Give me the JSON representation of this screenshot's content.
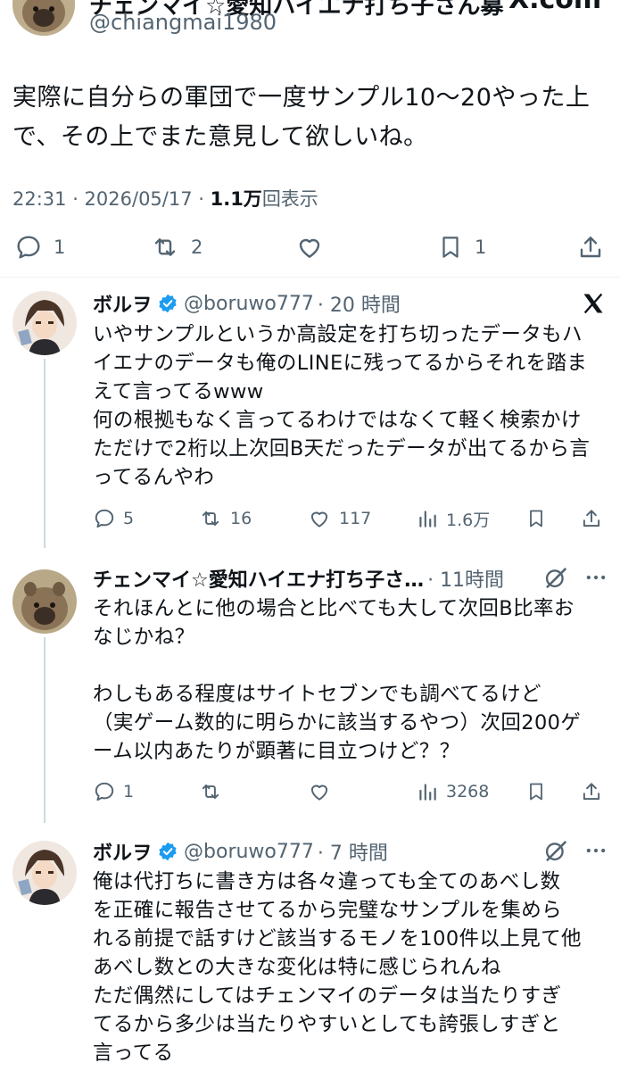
{
  "main_tweet": {
    "author_name": "チェンマイ☆愛知ハイエナ打ち子さん募",
    "brand": "X.com",
    "handle": "@chiangmai1980",
    "text_lines": [
      "実際に自分らの軍団で一度サンプル10〜20やった上",
      "で、その上でまた意見して欲しいね。"
    ],
    "time": "22:31 · 2026/05/17 · ",
    "views_count": "1.1万",
    "views_label": "回表示",
    "stats": {
      "replies": "1",
      "reposts": "2",
      "bookmarks": "1"
    }
  },
  "replies": [
    {
      "author_name": "ボルヲ",
      "handle": "@boruwo777",
      "time": "· 20 時間",
      "right_icon": "x-logo-icon",
      "text_lines": [
        "いやサンプルというか高設定を打ち切ったデータもハ",
        "イエナのデータも俺のLINEに残ってるからそれを踏ま",
        "えて言ってるwww",
        "何の根拠もなく言ってるわけではなくて軽く検索かけ",
        "ただけで2桁以上次回B天だったデータが出てるから言",
        "ってるんやわ"
      ],
      "stats": {
        "replies": "5",
        "reposts": "16",
        "likes": "117",
        "views": "1.6万"
      }
    },
    {
      "author_name": "チェンマイ☆愛知ハイエナ打ち子さ…",
      "handle": "",
      "time": "· 11時間",
      "right_icon": "grok-icon",
      "text_lines": [
        "それほんとに他の場合と比べても大して次回B比率お",
        "なじかね？",
        "",
        "わしもある程度はサイトセブンでも調べてるけど",
        "（実ゲーム数的に明らかに該当するやつ）次回200ゲ",
        "ーム以内あたりが顕著に目立つけど？？"
      ],
      "stats": {
        "replies": "1",
        "reposts": "",
        "likes": "",
        "views": "3268"
      }
    },
    {
      "author_name": "ボルヲ",
      "handle": "@boruwo777",
      "time": "· 7 時間",
      "right_icon": "grok-icon",
      "text_lines": [
        "俺は代打ちに書き方は各々違っても全てのあべし数",
        "を正確に報告させてるから完璧なサンプルを集めら",
        "れる前提で話すけど該当するモノを100件以上見て他",
        "あべし数との大きな変化は特に感じられんね",
        "ただ偶然にしてはチェンマイのデータは当たりすぎ",
        "てるから多少は当たりやすいとしても誇張しすぎと",
        "言ってる"
      ]
    }
  ],
  "colors": {
    "verified": "#1d9bf0",
    "thread_line": "#cfd9de",
    "muted_text": "#536471",
    "text": "#0f1419"
  }
}
